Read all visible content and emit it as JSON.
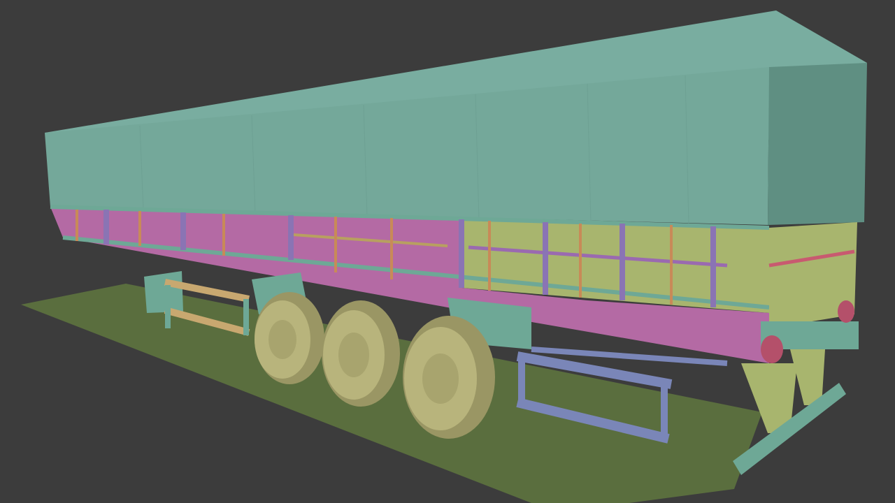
{
  "scene": {
    "subject": "grain-trailer-3d-model",
    "palette": {
      "background": "#3c3c3c",
      "ground": "#5a6e3e",
      "tarp": "#74a89a",
      "tarp_shadow": "#5f8f82",
      "side_panel": "#a8b56e",
      "rail_magenta": "#b46aa4",
      "posts_purple": "#8a74b4",
      "straps_orange": "#c88a58",
      "frame_teal": "#6ea896",
      "tire": "#b8b47c",
      "tire_shadow": "#9a9664",
      "guard_blue": "#7a86b8",
      "light_red": "#b4506a"
    }
  }
}
